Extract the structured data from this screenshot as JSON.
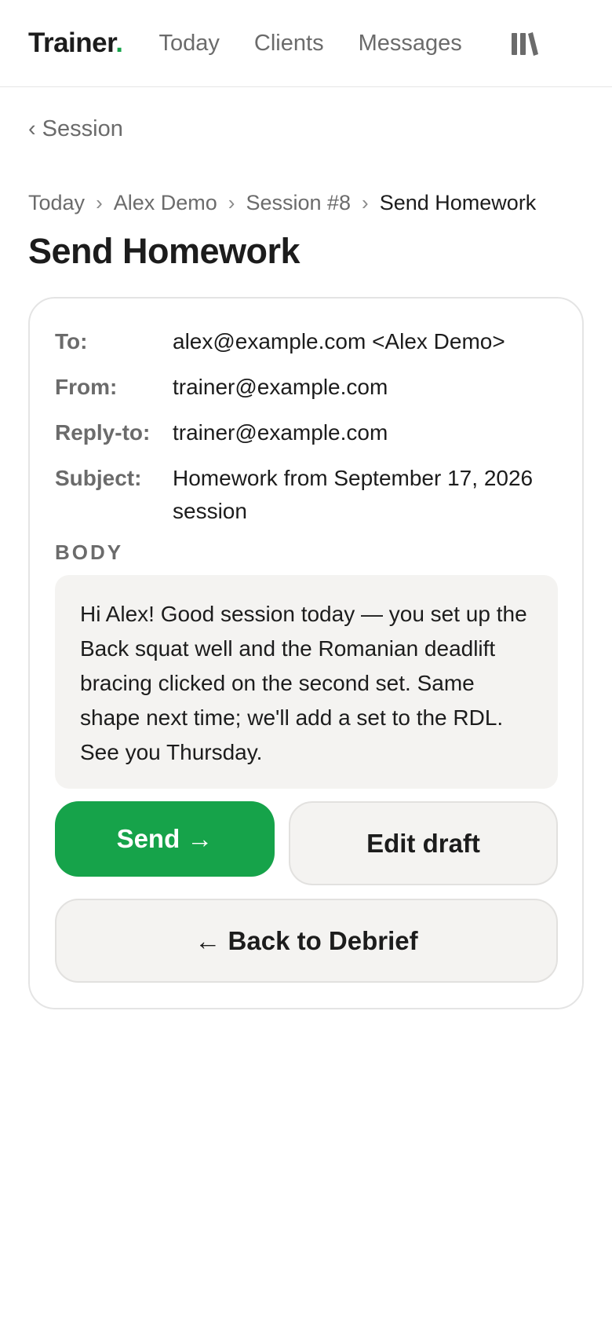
{
  "nav": {
    "brand": "Trainer",
    "brand_dot": ".",
    "links": [
      "Today",
      "Clients",
      "Messages"
    ],
    "menu_icon": "library-icon"
  },
  "back_link": {
    "chevron": "‹",
    "label": "Session"
  },
  "breadcrumb": {
    "items": [
      "Today",
      "Alex Demo",
      "Session #8"
    ],
    "separator": "›",
    "current": "Send Homework"
  },
  "page_title": "Send Homework",
  "email": {
    "to_label": "To:",
    "to_value": "alex@example.com <Alex Demo>",
    "from_label": "From:",
    "from_value": "trainer@example.com",
    "reply_label": "Reply-to:",
    "reply_value": "trainer@example.com",
    "subject_label": "Subject:",
    "subject_value": "Homework from September 17, 2026 session",
    "body_label": "BODY",
    "body_text": "Hi Alex! Good session today — you set up the Back squat well and the Romanian deadlift bracing clicked on the second set. Same shape next time; we'll add a set to the RDL. See you Thursday."
  },
  "actions": {
    "send": "Send →",
    "edit": "Edit draft",
    "back": "← Back to Debrief"
  },
  "colors": {
    "accent": "#16a34a",
    "muted_text": "#6b6b6b",
    "body_bg": "#f4f3f1"
  }
}
